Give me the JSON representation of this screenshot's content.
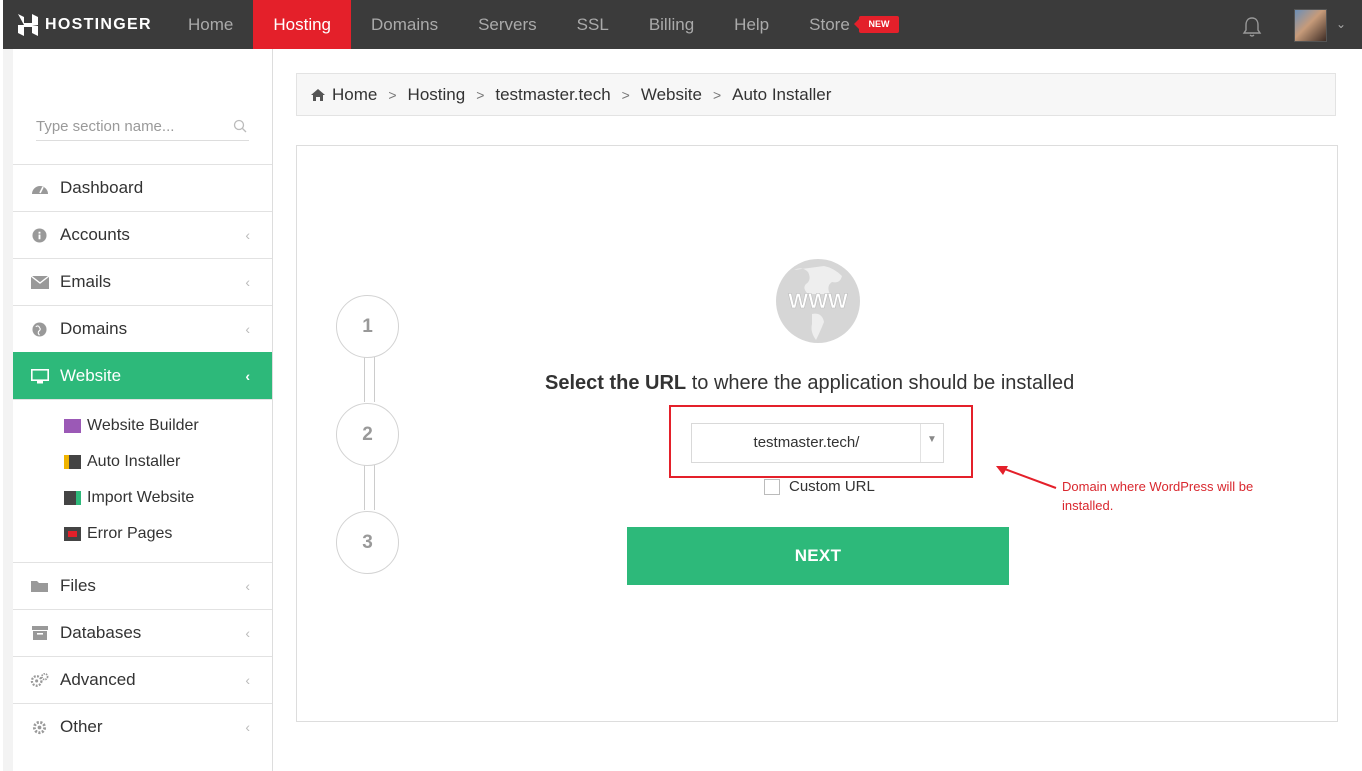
{
  "brand": {
    "name": "HOSTINGER"
  },
  "nav": {
    "items": [
      {
        "label": "Home"
      },
      {
        "label": "Hosting"
      },
      {
        "label": "Domains"
      },
      {
        "label": "Servers"
      },
      {
        "label": "SSL"
      },
      {
        "label": "Billing"
      },
      {
        "label": "Help"
      },
      {
        "label": "Store"
      }
    ],
    "store_badge": "NEW",
    "active": "Hosting"
  },
  "sidebar": {
    "search_placeholder": "Type section name...",
    "items": [
      {
        "label": "Dashboard",
        "icon": "dashboard-icon"
      },
      {
        "label": "Accounts",
        "icon": "info-icon"
      },
      {
        "label": "Emails",
        "icon": "envelope-icon"
      },
      {
        "label": "Domains",
        "icon": "globe-icon"
      },
      {
        "label": "Website",
        "icon": "monitor-icon"
      },
      {
        "label": "Files",
        "icon": "folder-icon"
      },
      {
        "label": "Databases",
        "icon": "archive-icon"
      },
      {
        "label": "Advanced",
        "icon": "cogs-icon"
      },
      {
        "label": "Other",
        "icon": "gear-icon"
      }
    ],
    "active": "Website",
    "website_sub": [
      {
        "label": "Website Builder",
        "icon": "website-builder-icon"
      },
      {
        "label": "Auto Installer",
        "icon": "auto-installer-icon"
      },
      {
        "label": "Import Website",
        "icon": "import-website-icon"
      },
      {
        "label": "Error Pages",
        "icon": "error-pages-icon"
      }
    ]
  },
  "breadcrumb": [
    "Home",
    "Hosting",
    "testmaster.tech",
    "Website",
    "Auto Installer"
  ],
  "installer": {
    "steps": [
      "1",
      "2",
      "3"
    ],
    "www_text": "WWW",
    "title_bold": "Select the URL",
    "title_rest": " to where the application should be installed",
    "url_value": "testmaster.tech/",
    "custom_url_label": "Custom URL",
    "next_label": "NEXT",
    "annotation": "Domain where WordPress will be installed."
  },
  "colors": {
    "topbar": "#3b3b3b",
    "brand_red": "#e4202a",
    "accent_green": "#2db97a",
    "annotation_red": "#d9272e"
  }
}
